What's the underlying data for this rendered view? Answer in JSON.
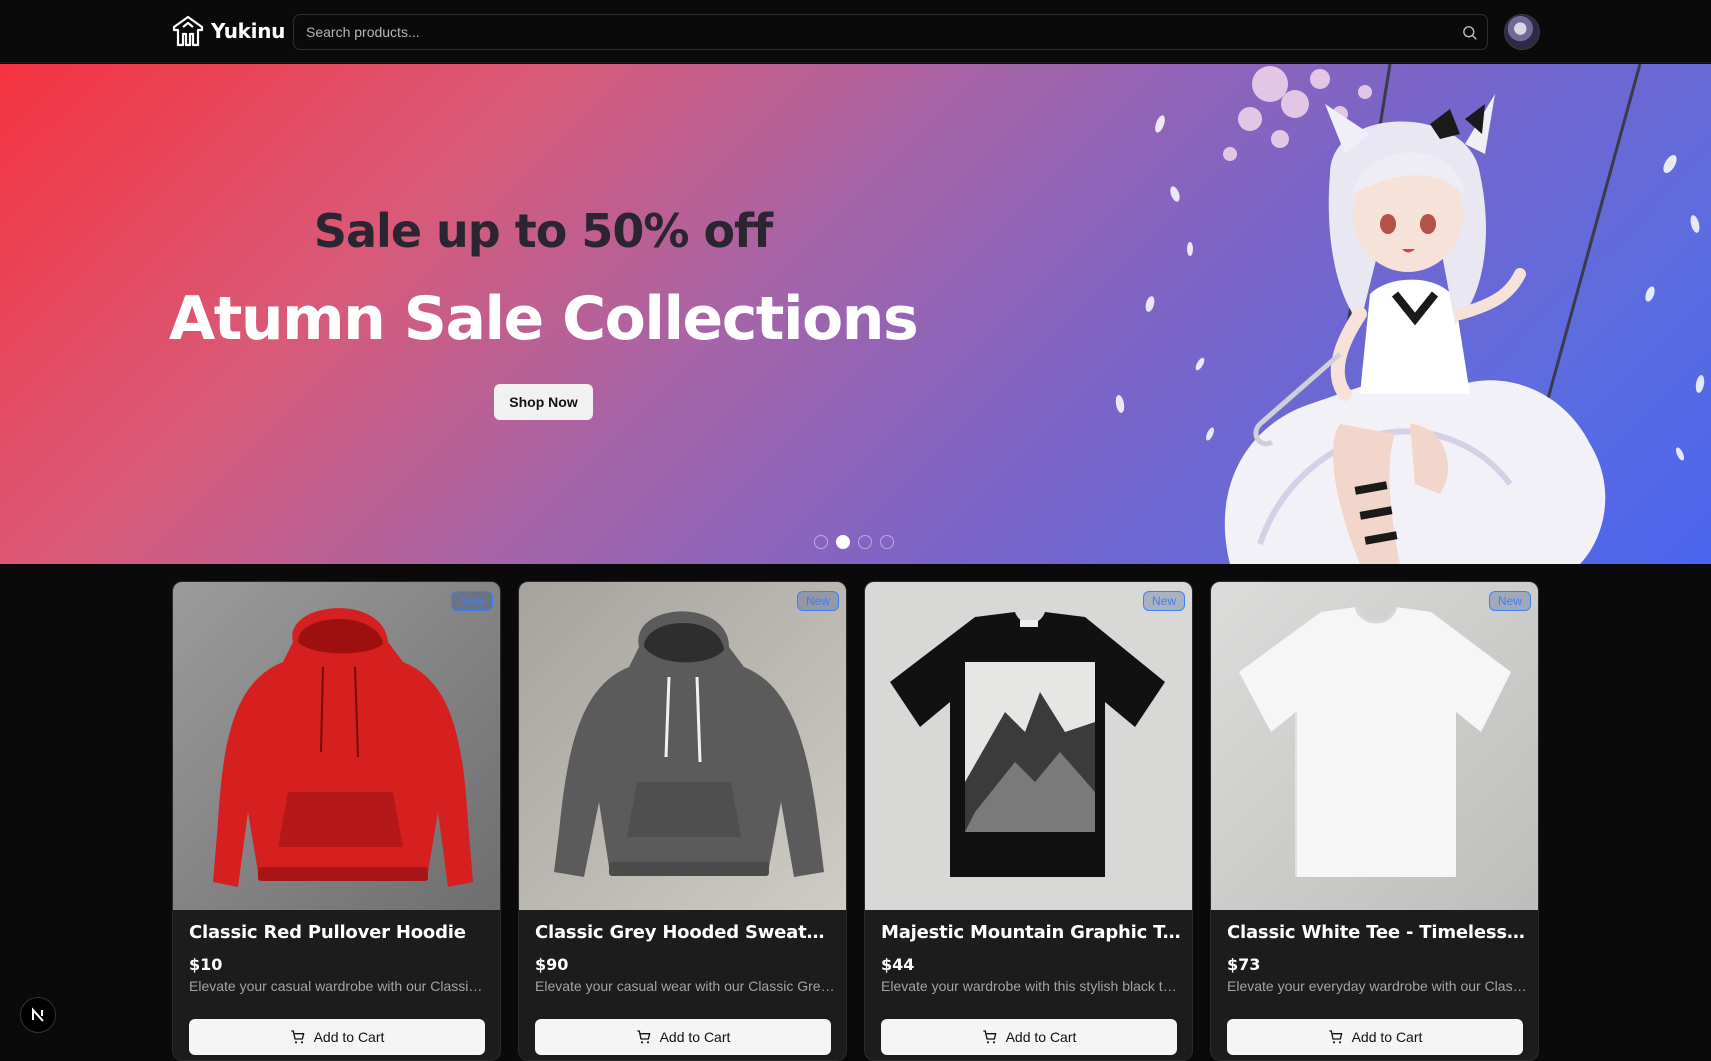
{
  "header": {
    "brand": "Yukinu",
    "search_placeholder": "Search products..."
  },
  "hero": {
    "subtitle": "Sale up to 50% off",
    "title": "Atumn Sale Collections",
    "cta_label": "Shop Now",
    "slides": 4,
    "active_slide": 2
  },
  "products": [
    {
      "name": "Classic Red Pullover Hoodie",
      "price": "$10",
      "description": "Elevate your casual wardrobe with our Classic Red Pullover Hoodie",
      "badge": "New",
      "cta": "Add to Cart",
      "color": "#d61f1f"
    },
    {
      "name": "Classic Grey Hooded Sweatshirt",
      "price": "$90",
      "description": "Elevate your casual wear with our Classic Grey Hooded Sweatshirt",
      "badge": "New",
      "cta": "Add to Cart",
      "color": "#5b5b5b"
    },
    {
      "name": "Majestic Mountain Graphic T-Shirt",
      "price": "$44",
      "description": "Elevate your wardrobe with this stylish black t-shirt",
      "badge": "New",
      "cta": "Add to Cart",
      "color": "#111111"
    },
    {
      "name": "Classic White Tee - Timeless Style and Comfort",
      "price": "$73",
      "description": "Elevate your everyday wardrobe with our Classic White Tee",
      "badge": "New",
      "cta": "Add to Cart",
      "color": "#f2f2f2"
    }
  ],
  "colors": {
    "background": "#0a0a0a",
    "card": "#1c1c1c",
    "badge": "#3b82f6",
    "hero_start": "#f5333f",
    "hero_end": "#4a64ee"
  },
  "icons": [
    "logo-icon",
    "search-icon",
    "cart-icon",
    "next-js-icon"
  ]
}
